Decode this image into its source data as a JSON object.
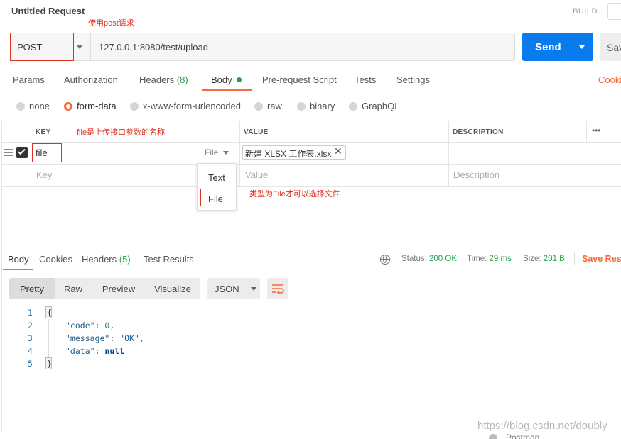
{
  "header": {
    "title": "Untitled Request",
    "build": "BUILD"
  },
  "annotations": {
    "post": "使用post请求",
    "key": "file是上传接口参数的名称",
    "file": "类型为File才可以选择文件"
  },
  "request": {
    "method": "POST",
    "url": "127.0.0.1:8080/test/upload",
    "send": "Send",
    "save": "Sav"
  },
  "tabs": [
    "Params",
    "Authorization",
    "Headers",
    "Body",
    "Pre-request Script",
    "Tests",
    "Settings"
  ],
  "headers_count": "(8)",
  "cookies_link": "Cooki",
  "body_modes": [
    "none",
    "form-data",
    "x-www-form-urlencoded",
    "raw",
    "binary",
    "GraphQL"
  ],
  "table": {
    "col_key": "KEY",
    "col_value": "VALUE",
    "col_desc": "DESCRIPTION",
    "more": "•••",
    "row_key": "file",
    "row_type": "File",
    "row_value": "新建 XLSX 工作表.xlsx",
    "ph_key": "Key",
    "ph_value": "Value",
    "ph_desc": "Description"
  },
  "dropdown": {
    "opt_text": "Text",
    "opt_file": "File"
  },
  "response": {
    "tabs": [
      "Body",
      "Cookies",
      "Headers",
      "Test Results"
    ],
    "headers_count": "(5)",
    "status_label": "Status:",
    "status_value": "200 OK",
    "time_label": "Time:",
    "time_value": "29 ms",
    "size_label": "Size:",
    "size_value": "201 B",
    "save_resp": "Save Resp",
    "views": [
      "Pretty",
      "Raw",
      "Preview",
      "Visualize"
    ],
    "format": "JSON"
  },
  "code": {
    "lines": [
      "1",
      "2",
      "3",
      "4",
      "5"
    ],
    "l1": "{",
    "code_key": "\"code\"",
    "code_val": "0",
    "msg_key": "\"message\"",
    "msg_val": "\"OK\"",
    "data_key": "\"data\"",
    "data_val": "null",
    "l5": "}"
  },
  "footer": {
    "brand": "Postman",
    "watermark": "https://blog.csdn.net/doubly"
  },
  "colors": {
    "accent": "#f26b3a",
    "send": "#097bed",
    "annotation": "#e0301e",
    "success": "#27a04b"
  }
}
